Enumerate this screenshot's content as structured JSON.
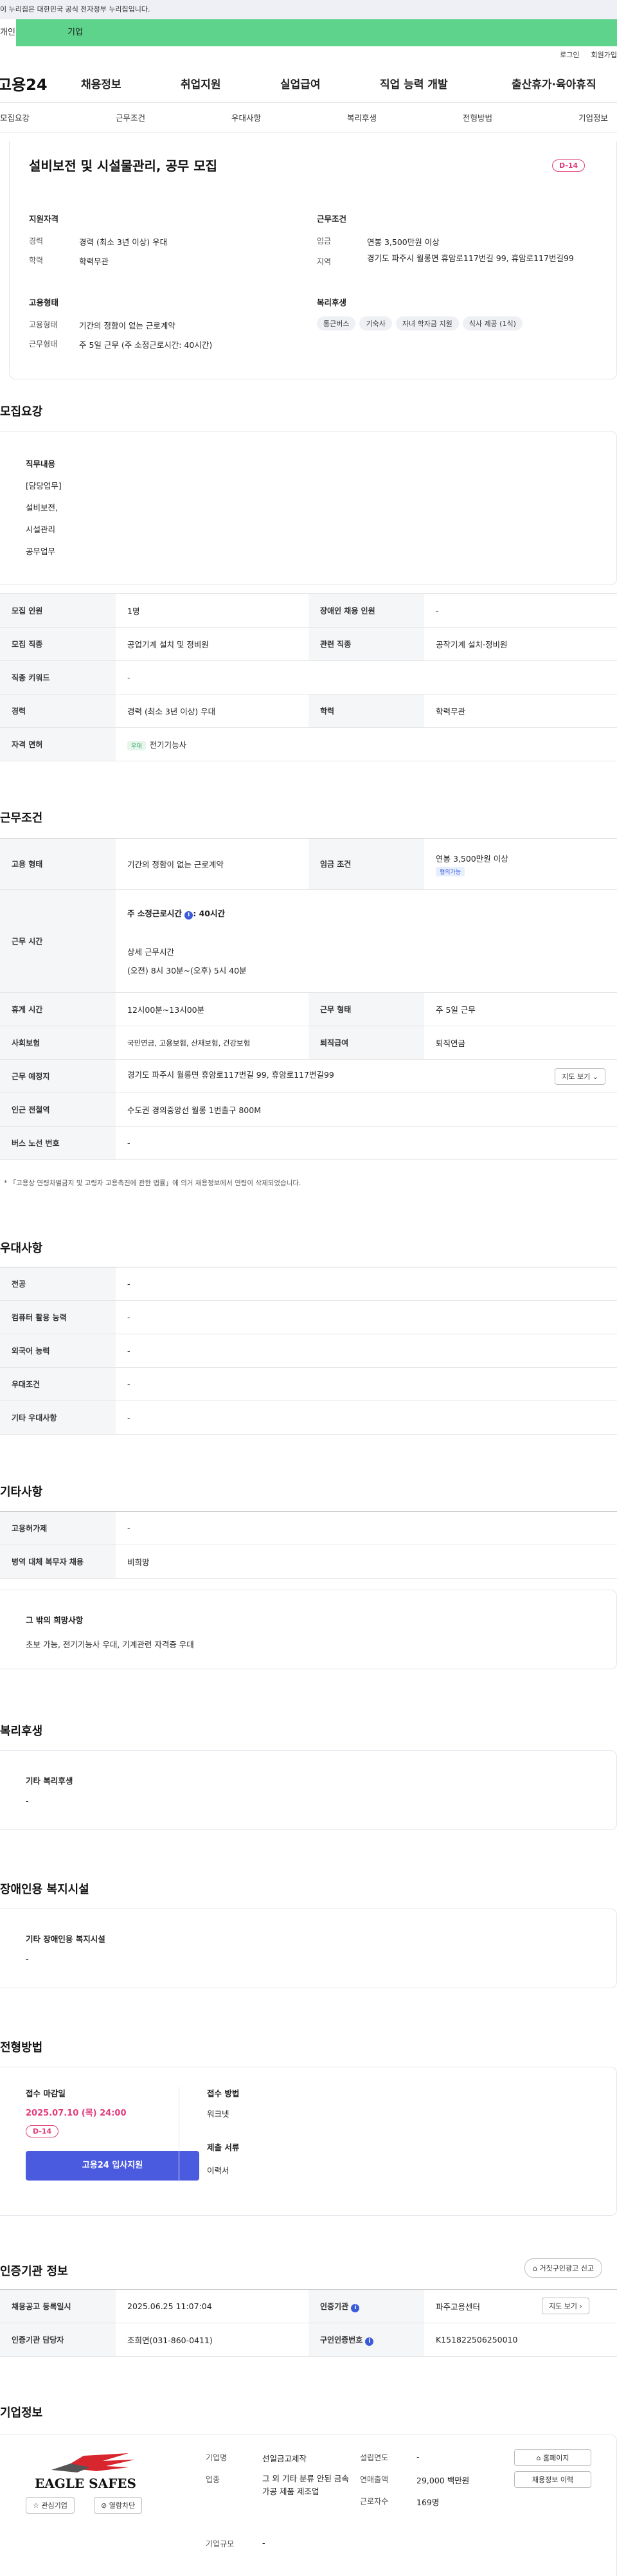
{
  "gov_banner": "이 누리집은 대한민국 공식 전자정부 누리집입니다.",
  "top_tabs": {
    "a": "개인",
    "b": "기업"
  },
  "util": {
    "login": "로그인",
    "join": "회원가입"
  },
  "logo": "고용24",
  "gnb": [
    "채용정보",
    "취업지원",
    "실업급여",
    "직업 능력 개발",
    "출산휴가·육아휴직"
  ],
  "snb": [
    "모집요강",
    "근무조건",
    "우대사항",
    "복리후생",
    "전형방법",
    "기업정보"
  ],
  "summary": {
    "title": "설비보전 및 시설물관리, 공무 모집",
    "dday": "D-14",
    "qual_h": "지원자격",
    "exp_l": "경력",
    "exp_v": "경력 (최소 3년 이상) 우대",
    "edu_l": "학력",
    "edu_v": "학력무관",
    "cond_h": "근무조건",
    "pay_l": "임금",
    "pay_v": "연봉 3,500만원 이상",
    "area_l": "지역",
    "area_v": "경기도 파주시 월롱면 휴암로117번길 99, 휴암로117번길99",
    "emp_h": "고용형태",
    "type_l": "고용형태",
    "type_v": "기간의 정함이 없는 근로계약",
    "form_l": "근무형태",
    "form_v": "주 5일 근무 (주 소정근로시간: 40시간)",
    "wel_h": "복리후생",
    "chips": [
      "통근버스",
      "기숙사",
      "자녀 학자금 지원",
      "식사 제공 (1식)"
    ]
  },
  "recruit": {
    "title": "모집요강",
    "duty_h": "직무내용",
    "duty": [
      "[담당업무]",
      "설비보전,",
      "시설관리",
      "공무업무"
    ],
    "rows": [
      {
        "k1": "모집 인원",
        "v1": "1명",
        "k2": "장애인 채용 인원",
        "v2": "-"
      },
      {
        "k1": "모집 직종",
        "v1": "공업기계 설치 및 정비원",
        "k2": "관련 직종",
        "v2": "공작기계 설치·정비원"
      },
      {
        "k1": "직종 키워드",
        "v1": "-"
      },
      {
        "k1": "경력",
        "v1": "경력 (최소 3년 이상) 우대",
        "k2": "학력",
        "v2": "학력무관"
      },
      {
        "k1": "자격 면허",
        "tag": "우대",
        "v1": "전기기능사"
      }
    ]
  },
  "work": {
    "title": "근무조건",
    "type_k": "고용 형태",
    "type_v": "기간의 정함이 없는 근로계약",
    "pay_k": "임금 조건",
    "pay_v": "연봉 3,500만원 이상",
    "pay_tag": "협의가능",
    "time_k": "근무 시간",
    "time_weekly": "주 소정근로시간",
    "time_weekly_v": ": 40시간",
    "time_detail_h": "상세 근무시간",
    "time_detail": "(오전) 8시 30분~(오후) 5시 40분",
    "rest_k": "휴게 시간",
    "rest_v": "12시00분~13시00분",
    "form_k": "근무 형태",
    "form_v": "주 5일 근무",
    "ins_k": "사회보험",
    "ins_v": "국민연금, 고용보험, 산재보험, 건강보험",
    "ret_k": "퇴직급여",
    "ret_v": "퇴직연금",
    "loc_k": "근무 예정지",
    "loc_v": "경기도 파주시 월롱면 휴암로117번길 99, 휴암로117번길99",
    "map_btn": "지도 보기",
    "sub_k": "인근 전철역",
    "sub_v": "수도권 경의중앙선 월롱 1번출구 800M",
    "bus_k": "버스 노선 번호",
    "bus_v": "-",
    "note": "* 「고용상 연령차별금지 및 고령자 고용촉진에 관한 법률」에 의거 채용정보에서 연령이 삭제되었습니다."
  },
  "pref": {
    "title": "우대사항",
    "rows": [
      {
        "k": "전공",
        "v": "-"
      },
      {
        "k": "컴퓨터 활용 능력",
        "v": "-"
      },
      {
        "k": "외국어 능력",
        "v": "-"
      },
      {
        "k": "우대조건",
        "v": "-"
      },
      {
        "k": "기타 우대사항",
        "v": "-"
      }
    ]
  },
  "etc": {
    "title": "기타사항",
    "rows": [
      {
        "k": "고용허가제",
        "v": "-"
      },
      {
        "k": "병역 대체 복무자 채용",
        "v": "비희망"
      }
    ],
    "box_h": "그 밖의 희망사항",
    "box_v": "초보 가능, 전기기능사 우대, 기계관련 자격증 우대"
  },
  "welfare": {
    "title": "복리후생",
    "box_h": "기타 복리후생",
    "box_v": "-"
  },
  "disab": {
    "title": "장애인용 복지시설",
    "box_h": "기타 장애인용 복지시설",
    "box_v": "-"
  },
  "process": {
    "title": "전형방법",
    "deadline_h": "접수 마감일",
    "deadline": "2025.07.10 (목) 24:00",
    "dday": "D-14",
    "apply": "고용24 입사지원",
    "method_h": "접수 방법",
    "method_v": "워크넷",
    "docs_h": "제출 서류",
    "docs_v": "이력서"
  },
  "agency": {
    "title": "인증기관 정보",
    "report": "거짓구인광고 신고",
    "reg_k": "채용공고 등록일시",
    "reg_v": "2025.06.25 11:07:04",
    "org_k": "인증기관",
    "org_v": "파주고용센터",
    "map_btn": "지도 보기",
    "mgr_k": "인증기관 담당자",
    "mgr_v": "조희연(031-860-0411)",
    "no_k": "구인인증번호",
    "no_v": "K151822506250010"
  },
  "company": {
    "title": "기업정보",
    "logo_text": "EAGLE SAFES",
    "fav": "관심기업",
    "block": "열람차단",
    "name_k": "기업명",
    "name_v": "선일금고제작",
    "est_k": "설립연도",
    "est_v": "-",
    "ind_k": "업종",
    "ind_v": "그 외 기타 분류 안된 금속 가공 제품 제조업",
    "sales_k": "연매출액",
    "sales_v": "29,000 백만원",
    "emp_k": "근로자수",
    "emp_v": "169명",
    "size_k": "기업규모",
    "size_v": "-",
    "home_btn": "홈페이지",
    "jobs_btn": "채용정보 이력"
  },
  "colors": {
    "accent": "#5dd38c",
    "dday": "#e23c7a",
    "apply": "#4a5be0"
  }
}
